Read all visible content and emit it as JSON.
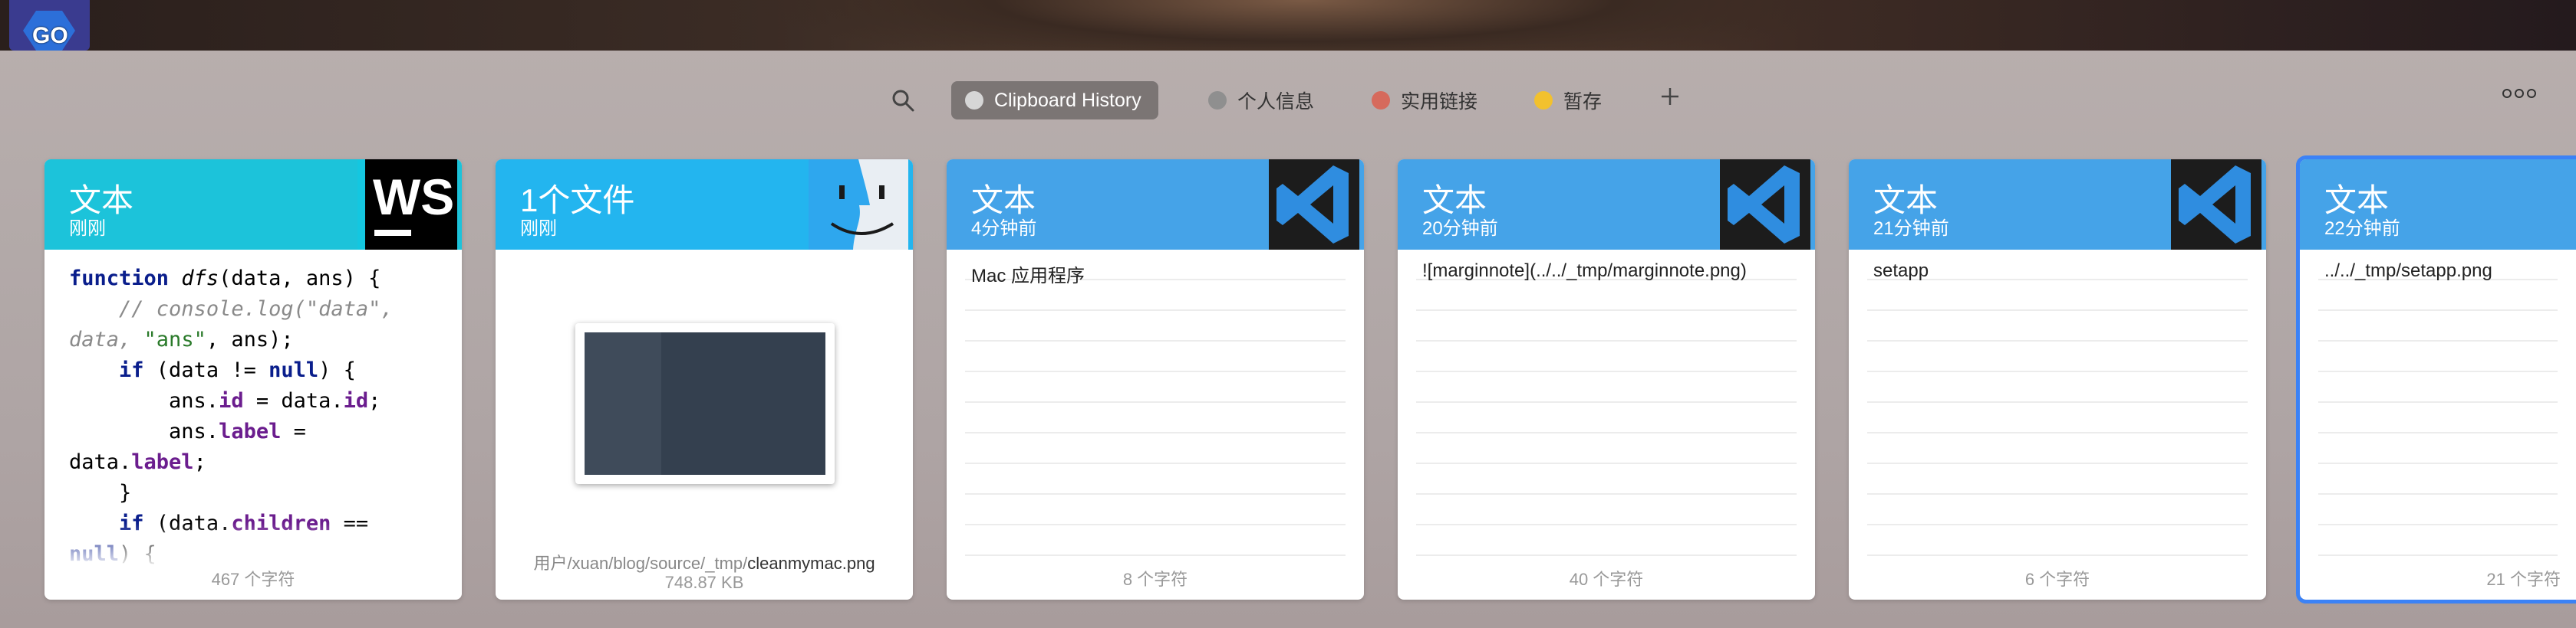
{
  "toolbar": {
    "tabs": [
      {
        "label": "Clipboard History",
        "color": "#c9c9c9",
        "active": true
      },
      {
        "label": "个人信息",
        "color": "#9a9a9a",
        "active": false
      },
      {
        "label": "实用链接",
        "color": "#d66a5c",
        "active": false
      },
      {
        "label": "暂存",
        "color": "#f2c12e",
        "active": false
      }
    ]
  },
  "dock_badge": "GO",
  "cards": [
    {
      "type": "文本",
      "time": "刚刚",
      "app": "webstorm",
      "footer": "467 个字符",
      "header_color": "#1cc3da",
      "code": [
        "function dfs(data, ans) {",
        "    // console.log(\"data\",",
        "data, \"ans\", ans);",
        "    if (data != null) {",
        "        ans.id = data.id;",
        "        ans.label =",
        "data.label;",
        "    }",
        "    if (data.children ==",
        "null) {"
      ]
    },
    {
      "type": "1个文件",
      "time": "刚刚",
      "app": "finder",
      "header_color": "#23b5ef",
      "path_prefix": "用户/xuan/blog/source/_tmp/",
      "path_file": "cleanmymac.png",
      "size": "748.87 KB"
    },
    {
      "type": "文本",
      "time": "4分钟前",
      "app": "vscode",
      "text": "Mac 应用程序",
      "footer": "8 个字符",
      "header_color": "#45a3e8"
    },
    {
      "type": "文本",
      "time": "20分钟前",
      "app": "vscode",
      "text": "![marginnote](../../_tmp/marginnote.png)",
      "footer": "40 个字符",
      "header_color": "#45a3e8"
    },
    {
      "type": "文本",
      "time": "21分钟前",
      "app": "vscode",
      "text": "setapp",
      "footer": "6 个字符",
      "header_color": "#45a3e8"
    },
    {
      "type": "文本",
      "time": "22分钟前",
      "app": "vscode",
      "text": "../../_tmp/setapp.png",
      "footer": "21 个字符",
      "header_color": "#45a3e8"
    }
  ]
}
